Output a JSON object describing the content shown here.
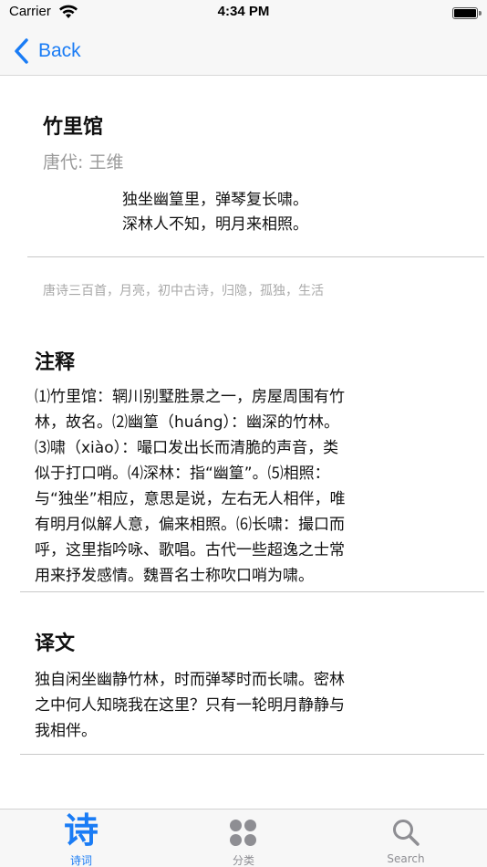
{
  "status_bar": {
    "carrier": "Carrier",
    "time": "4:34 PM",
    "wifi_icon": "wifi-icon",
    "battery_icon": "battery-icon"
  },
  "nav": {
    "back_label": "Back",
    "back_icon": "chevron-left-icon",
    "accent_color": "#1a7cf5"
  },
  "poem": {
    "title": "竹里馆",
    "author": "唐代: 王维",
    "lines": [
      "独坐幽篁里，弹琴复长啸。",
      "深林人不知，明月来相照。"
    ],
    "tags": "唐诗三百首，月亮，初中古诗，归隐，孤独，生活"
  },
  "notes": {
    "title": "注释",
    "lines": [
      "⑴竹里馆：辋川别墅胜景之一，房屋周围有竹",
      "林，故名。⑵幽篁（huáng）：幽深的竹林。",
      "⑶啸（xiào）：嘬口发出长而清脆的声音，类",
      "似于打口哨。⑷深林：指“幽篁”。⑸相照：",
      "与“独坐”相应，意思是说，左右无人相伴，唯",
      "有明月似解人意，偏来相照。⑹长啸：撮口而",
      "呼，这里指吟咏、歌唱。古代一些超逸之士常",
      "用来抒发感情。魏晋名士称吹口哨为啸。"
    ]
  },
  "translation": {
    "title": "译文",
    "lines": [
      "独自闲坐幽静竹林，时而弹琴时而长啸。密林",
      "之中何人知晓我在这里？只有一轮明月静静与",
      "我相伴。"
    ]
  },
  "tab_bar": {
    "tabs": [
      {
        "label": "诗词",
        "icon_glyph": "诗",
        "icon": "poem-glyph-icon",
        "active": true
      },
      {
        "label": "分类",
        "icon": "grid-dots-icon",
        "active": false
      },
      {
        "label": "Search",
        "icon": "search-icon",
        "active": false
      }
    ],
    "active_color": "#1a7cf5",
    "inactive_color": "#8e8e93"
  }
}
